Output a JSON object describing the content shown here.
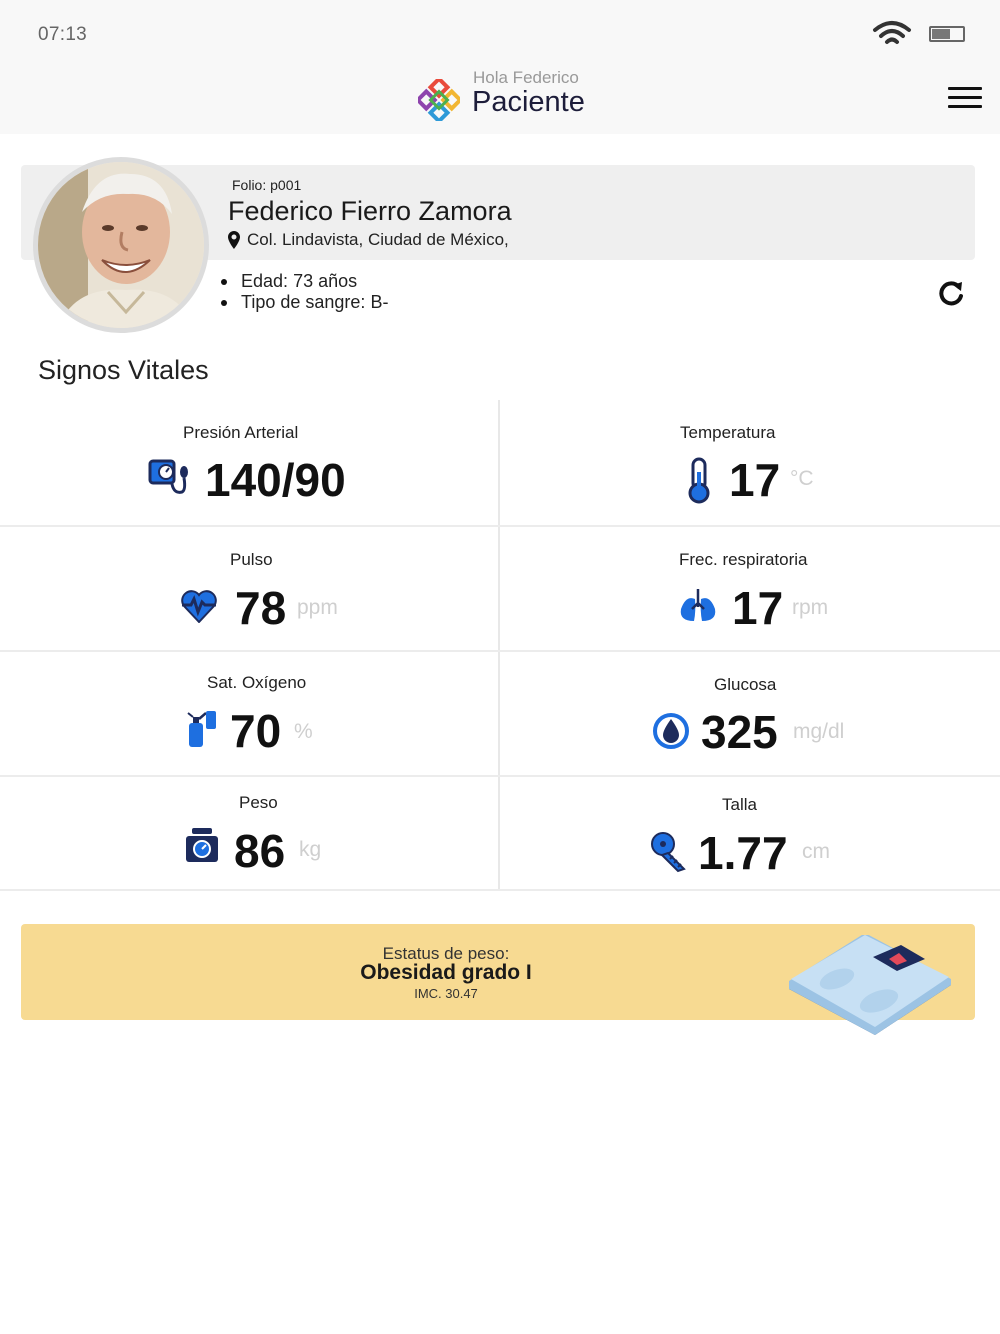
{
  "status_bar": {
    "time": "07:13"
  },
  "header": {
    "greeting": "Hola Federico",
    "title": "Paciente"
  },
  "patient": {
    "folio": "Folio: p001",
    "name": "Federico Fierro Zamora",
    "address": "Col. Lindavista, Ciudad de México,",
    "age_label": "Edad:",
    "age_value": "73 años",
    "blood_label": "Tipo de sangre:",
    "blood_value": "B-"
  },
  "section_title": "Signos Vitales",
  "vitals": {
    "presion": {
      "label": "Presión Arterial",
      "value": "140/90",
      "unit": ""
    },
    "temperatura": {
      "label": "Temperatura",
      "value": "17",
      "unit": "°C"
    },
    "pulso": {
      "label": "Pulso",
      "value": "78",
      "unit": "ppm"
    },
    "respiratoria": {
      "label": "Frec. respiratoria",
      "value": "17",
      "unit": "rpm"
    },
    "oxigeno": {
      "label": "Sat. Oxígeno",
      "value": "70",
      "unit": "%"
    },
    "glucosa": {
      "label": "Glucosa",
      "value": "325",
      "unit": "mg/dl"
    },
    "peso": {
      "label": "Peso",
      "value": "86",
      "unit": "kg"
    },
    "talla": {
      "label": "Talla",
      "value": "1.77",
      "unit": "cm"
    }
  },
  "weight_status": {
    "label": "Estatus de peso:",
    "value": "Obesidad grado I",
    "imc": "IMC. 30.47"
  },
  "colors": {
    "accent_blue": "#1e6fe0",
    "dark_navy": "#1d2b5c",
    "status_card": "#f7da92",
    "unit_gray": "#cfcfcf"
  },
  "icons": {
    "blood_pressure": "blood-pressure-monitor-icon",
    "temperature": "thermometer-icon",
    "pulse": "heart-pulse-icon",
    "respiratory": "lungs-icon",
    "oxygen": "oxygen-tank-icon",
    "glucose": "blood-drop-icon",
    "weight": "weighing-scale-icon",
    "height": "measuring-tape-icon",
    "menu": "hamburger-menu-icon",
    "refresh": "refresh-icon",
    "location": "map-pin-icon"
  }
}
